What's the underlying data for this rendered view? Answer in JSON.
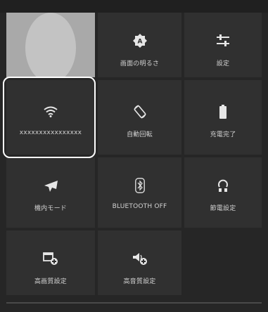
{
  "tiles": {
    "brightness": {
      "label": "画面の明るさ",
      "icon": "brightness-auto-icon"
    },
    "settings": {
      "label": "設定",
      "icon": "sliders-icon"
    },
    "wifi": {
      "label": "xxxxxxxxxxxxxxxx",
      "icon": "wifi-icon"
    },
    "rotate": {
      "label": "自動回転",
      "icon": "screen-rotate-icon"
    },
    "battery": {
      "label": "充電完了",
      "icon": "battery-full-icon"
    },
    "airplane": {
      "label": "機内モード",
      "icon": "airplane-icon"
    },
    "bluetooth": {
      "label": "BLUETOOTH OFF",
      "icon": "bluetooth-icon"
    },
    "power_saving": {
      "label": "節電設定",
      "icon": "power-saving-icon"
    },
    "hq_display": {
      "label": "高画質設定",
      "icon": "hq-display-icon"
    },
    "hq_audio": {
      "label": "高音質設定",
      "icon": "hq-audio-icon"
    }
  },
  "colors": {
    "background": "#262626",
    "tile": "#303030",
    "highlight": "#ffffff",
    "label": "#d2d2d2"
  }
}
